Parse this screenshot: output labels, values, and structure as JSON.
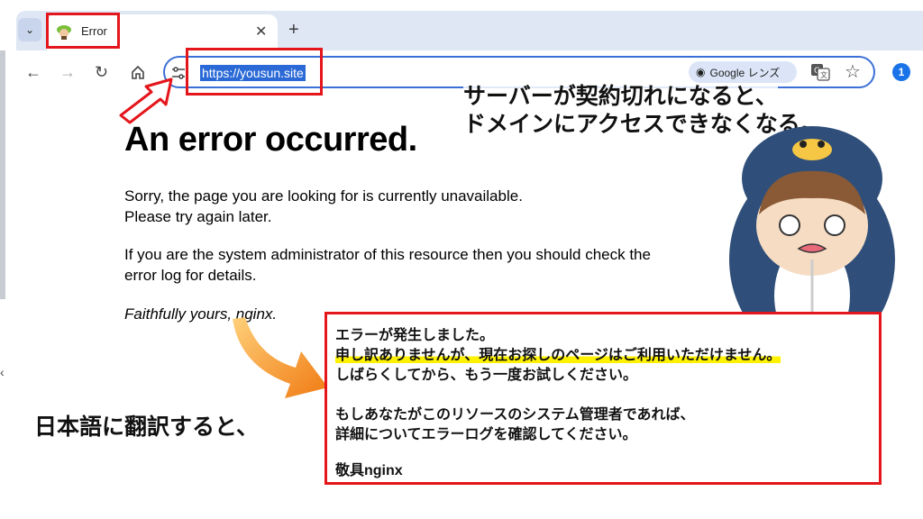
{
  "browser": {
    "tab": {
      "title": "Error"
    },
    "address_bar": {
      "url": "https://yousun.site"
    },
    "lens_label": "Google レンズ"
  },
  "page": {
    "heading": "An error occurred.",
    "paragraphs": [
      "Sorry, the page you are looking for is currently unavailable.",
      "Please try again later.",
      "If you are the system administrator of this resource then you should check the",
      "error log for details.",
      "Faithfully yours, nginx."
    ]
  },
  "annotations": {
    "top_note": [
      "サーバーが契約切れになると、",
      "ドメインにアクセスできなくなる。"
    ],
    "translation_lines": [
      "エラーが発生しました。",
      "申し訳ありませんが、現在お探しのページはご利用いただけません。",
      "しばらくしてから、もう一度お試しください。",
      "",
      "もしあなたがこのリソースのシステム管理者であれば、",
      "詳細についてエラーログを確認してください。",
      "",
      "敬具nginx"
    ],
    "bottom_note": "日本語に翻訳すると、"
  },
  "colors": {
    "accent_red": "#e4161b",
    "highlight_yellow": "#fff200",
    "url_selection": "#2b6ad6",
    "tabstrip": "#dfe7f5",
    "arrow_orange": "#f39a1e"
  }
}
